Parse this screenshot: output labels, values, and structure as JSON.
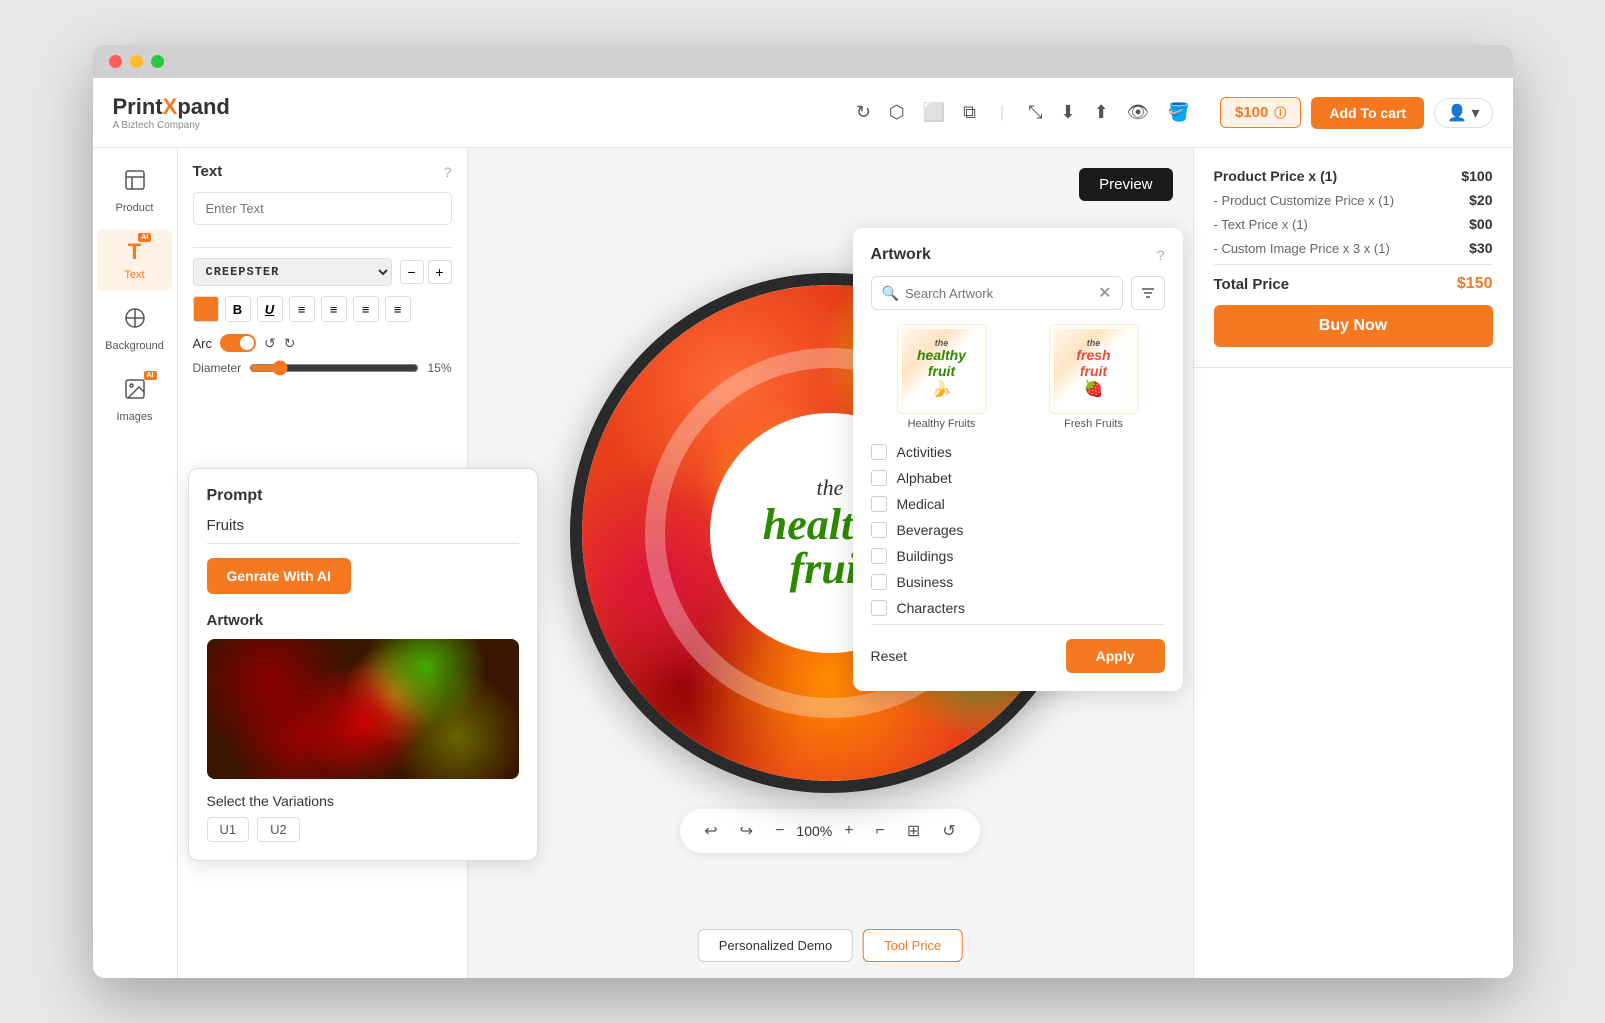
{
  "browser": {
    "traffic_lights": [
      "red",
      "yellow",
      "green"
    ]
  },
  "header": {
    "logo_text": "Print",
    "logo_span": "X",
    "logo_rest": "pand",
    "logo_sub": "A Biztech Company",
    "price_badge": "$100",
    "add_to_cart_label": "Add To cart",
    "icons": [
      "rotate",
      "layers",
      "frame",
      "duplicate",
      "expand",
      "download",
      "share",
      "eye",
      "paint"
    ]
  },
  "sidebar": {
    "items": [
      {
        "id": "product",
        "label": "Product",
        "icon": "🖼️",
        "active": false
      },
      {
        "id": "text",
        "label": "Text",
        "icon": "T",
        "active": true,
        "has_ai": true
      },
      {
        "id": "background",
        "label": "Background",
        "icon": "🎨",
        "active": false
      },
      {
        "id": "images",
        "label": "Images",
        "icon": "🖼",
        "active": false,
        "has_ai": true
      }
    ]
  },
  "text_panel": {
    "title": "Text",
    "placeholder": "Enter Text",
    "font_name": "CREEPSTER",
    "arc_label": "Arc",
    "diameter_label": "Diameter",
    "diameter_value": "15%"
  },
  "ai_panel": {
    "prompt_title": "Prompt",
    "prompt_text": "Fruits",
    "generate_btn": "Genrate With AI",
    "artwork_title": "Artwork",
    "variations_title": "Select the Variations",
    "variations": [
      "U1",
      "U2"
    ]
  },
  "canvas": {
    "preview_label": "Preview",
    "zoom_level": "100%",
    "product_text_1": "the",
    "product_text_2": "healthy",
    "product_text_3": "fruit"
  },
  "price_panel": {
    "product_price_label": "Product Price  x  (1)",
    "product_price_value": "$100",
    "customize_label": "- Product Customize Price  x  (1)",
    "customize_value": "$20",
    "text_price_label": "- Text Price x (1)",
    "text_price_value": "$00",
    "custom_image_label": "- Custom Image Price x 3 x  (1)",
    "custom_image_value": "$30",
    "total_label": "Total Price",
    "total_value": "$150",
    "buy_btn": "Buy Now"
  },
  "artwork_panel": {
    "title": "Artwork",
    "search_placeholder": "Search Artwork",
    "items": [
      {
        "id": "healthy-fruits",
        "label": "Healthy Fruits"
      },
      {
        "id": "fresh-fruits",
        "label": "Fresh Fruits"
      }
    ],
    "categories": [
      {
        "id": "activities",
        "label": "Activities"
      },
      {
        "id": "alphabet",
        "label": "Alphabet"
      },
      {
        "id": "medical",
        "label": "Medical"
      },
      {
        "id": "beverages",
        "label": "Beverages"
      },
      {
        "id": "buildings",
        "label": "Buildings"
      },
      {
        "id": "business",
        "label": "Business"
      },
      {
        "id": "characters",
        "label": "Characters"
      }
    ],
    "reset_btn": "Reset",
    "apply_btn": "Apply"
  },
  "bottom_bar": {
    "personalized_demo": "Personalized Demo",
    "tool_price": "Tool Price"
  }
}
